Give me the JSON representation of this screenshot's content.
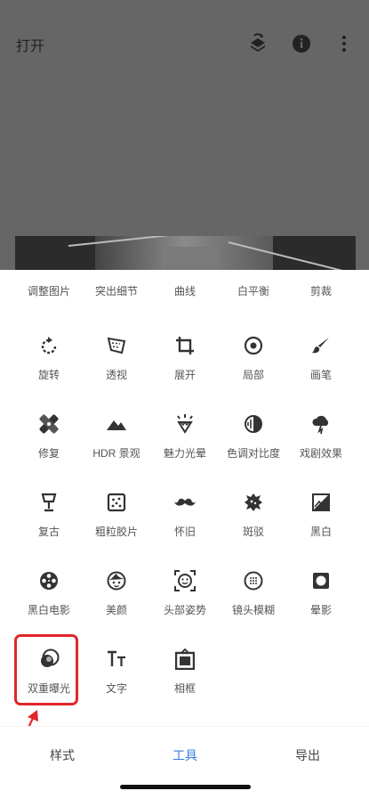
{
  "header": {
    "title": "打开"
  },
  "icons": {
    "layers": "layers-icon",
    "info": "info-icon",
    "more": "more-vert-icon"
  },
  "tools": {
    "row0": [
      {
        "label": "调整图片",
        "icon": "tune-icon"
      },
      {
        "label": "突出细节",
        "icon": "details-icon"
      },
      {
        "label": "曲线",
        "icon": "curves-icon"
      },
      {
        "label": "白平衡",
        "icon": "white-balance-icon"
      },
      {
        "label": "剪裁",
        "icon": "crop-icon"
      }
    ],
    "row1": [
      {
        "label": "旋转",
        "icon": "rotate-icon"
      },
      {
        "label": "透视",
        "icon": "perspective-icon"
      },
      {
        "label": "展开",
        "icon": "expand-icon"
      },
      {
        "label": "局部",
        "icon": "selective-icon"
      },
      {
        "label": "画笔",
        "icon": "brush-icon"
      }
    ],
    "row2": [
      {
        "label": "修复",
        "icon": "healing-icon"
      },
      {
        "label": "HDR 景观",
        "icon": "hdr-scape-icon"
      },
      {
        "label": "魅力光晕",
        "icon": "glamour-glow-icon"
      },
      {
        "label": "色调对比度",
        "icon": "tonal-contrast-icon"
      },
      {
        "label": "戏剧效果",
        "icon": "drama-icon"
      }
    ],
    "row3": [
      {
        "label": "复古",
        "icon": "vintage-lamp-icon"
      },
      {
        "label": "粗粒胶片",
        "icon": "grainy-film-icon"
      },
      {
        "label": "怀旧",
        "icon": "retrolux-mustache-icon"
      },
      {
        "label": "斑驳",
        "icon": "grunge-icon"
      },
      {
        "label": "黑白",
        "icon": "black-white-icon"
      }
    ],
    "row4": [
      {
        "label": "黑白电影",
        "icon": "noir-film-reel-icon"
      },
      {
        "label": "美颜",
        "icon": "face-retouch-icon"
      },
      {
        "label": "头部姿势",
        "icon": "head-pose-icon"
      },
      {
        "label": "镜头模糊",
        "icon": "lens-blur-icon"
      },
      {
        "label": "晕影",
        "icon": "vignette-icon"
      }
    ],
    "row5": [
      {
        "label": "双重曝光",
        "icon": "double-exposure-icon"
      },
      {
        "label": "文字",
        "icon": "text-icon"
      },
      {
        "label": "相框",
        "icon": "frames-icon"
      }
    ]
  },
  "nav": {
    "styles": "样式",
    "tools": "工具",
    "export": "导出"
  },
  "colors": {
    "accent": "#3b7de0",
    "highlight": "#e0262a",
    "dim": "#666666"
  }
}
